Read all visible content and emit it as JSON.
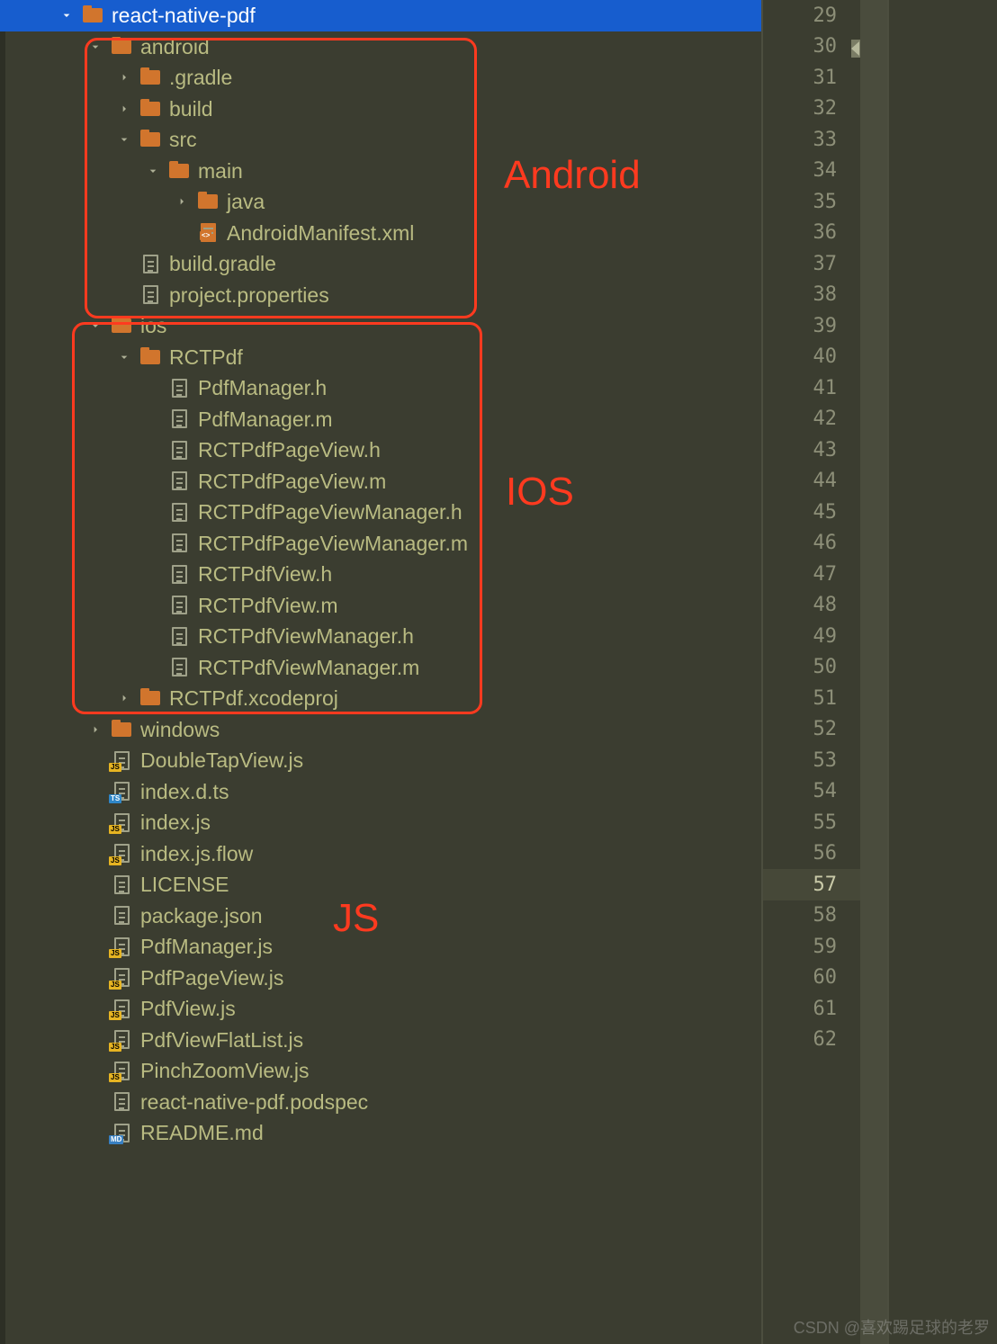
{
  "tree": [
    {
      "depth": 2,
      "chev": "down",
      "icon": "folder",
      "label": "react-native-pdf",
      "selected": true
    },
    {
      "depth": 3,
      "chev": "down",
      "icon": "folder",
      "label": "android"
    },
    {
      "depth": 4,
      "chev": "right",
      "icon": "folder",
      "label": ".gradle"
    },
    {
      "depth": 4,
      "chev": "right",
      "icon": "folder",
      "label": "build"
    },
    {
      "depth": 4,
      "chev": "down",
      "icon": "folder",
      "label": "src"
    },
    {
      "depth": 5,
      "chev": "down",
      "icon": "folder",
      "label": "main"
    },
    {
      "depth": 6,
      "chev": "right",
      "icon": "folder",
      "label": "java"
    },
    {
      "depth": 6,
      "chev": "none",
      "icon": "file-xml",
      "label": "AndroidManifest.xml"
    },
    {
      "depth": 4,
      "chev": "none",
      "icon": "file",
      "label": "build.gradle"
    },
    {
      "depth": 4,
      "chev": "none",
      "icon": "file",
      "label": "project.properties"
    },
    {
      "depth": 3,
      "chev": "down",
      "icon": "folder",
      "label": "ios"
    },
    {
      "depth": 4,
      "chev": "down",
      "icon": "folder",
      "label": "RCTPdf"
    },
    {
      "depth": 5,
      "chev": "none",
      "icon": "file",
      "label": "PdfManager.h"
    },
    {
      "depth": 5,
      "chev": "none",
      "icon": "file",
      "label": "PdfManager.m"
    },
    {
      "depth": 5,
      "chev": "none",
      "icon": "file",
      "label": "RCTPdfPageView.h"
    },
    {
      "depth": 5,
      "chev": "none",
      "icon": "file",
      "label": "RCTPdfPageView.m"
    },
    {
      "depth": 5,
      "chev": "none",
      "icon": "file",
      "label": "RCTPdfPageViewManager.h"
    },
    {
      "depth": 5,
      "chev": "none",
      "icon": "file",
      "label": "RCTPdfPageViewManager.m"
    },
    {
      "depth": 5,
      "chev": "none",
      "icon": "file",
      "label": "RCTPdfView.h"
    },
    {
      "depth": 5,
      "chev": "none",
      "icon": "file",
      "label": "RCTPdfView.m"
    },
    {
      "depth": 5,
      "chev": "none",
      "icon": "file",
      "label": "RCTPdfViewManager.h"
    },
    {
      "depth": 5,
      "chev": "none",
      "icon": "file",
      "label": "RCTPdfViewManager.m"
    },
    {
      "depth": 4,
      "chev": "right",
      "icon": "folder",
      "label": "RCTPdf.xcodeproj"
    },
    {
      "depth": 3,
      "chev": "right",
      "icon": "folder",
      "label": "windows"
    },
    {
      "depth": 3,
      "chev": "none",
      "icon": "file-js",
      "label": "DoubleTapView.js"
    },
    {
      "depth": 3,
      "chev": "none",
      "icon": "file-ts",
      "label": "index.d.ts"
    },
    {
      "depth": 3,
      "chev": "none",
      "icon": "file-js",
      "label": "index.js"
    },
    {
      "depth": 3,
      "chev": "none",
      "icon": "file-js",
      "label": "index.js.flow"
    },
    {
      "depth": 3,
      "chev": "none",
      "icon": "file",
      "label": "LICENSE"
    },
    {
      "depth": 3,
      "chev": "none",
      "icon": "file",
      "label": "package.json"
    },
    {
      "depth": 3,
      "chev": "none",
      "icon": "file-js",
      "label": "PdfManager.js"
    },
    {
      "depth": 3,
      "chev": "none",
      "icon": "file-js",
      "label": "PdfPageView.js"
    },
    {
      "depth": 3,
      "chev": "none",
      "icon": "file-js",
      "label": "PdfView.js"
    },
    {
      "depth": 3,
      "chev": "none",
      "icon": "file-js",
      "label": "PdfViewFlatList.js"
    },
    {
      "depth": 3,
      "chev": "none",
      "icon": "file-js",
      "label": "PinchZoomView.js"
    },
    {
      "depth": 3,
      "chev": "none",
      "icon": "file",
      "label": "react-native-pdf.podspec"
    },
    {
      "depth": 3,
      "chev": "none",
      "icon": "file-md",
      "label": "README.md"
    }
  ],
  "annotations": {
    "android": "Android",
    "ios": "IOS",
    "js": "JS"
  },
  "line_numbers": {
    "start": 29,
    "end": 62,
    "current": 57
  },
  "watermark": "CSDN @喜欢踢足球的老罗"
}
